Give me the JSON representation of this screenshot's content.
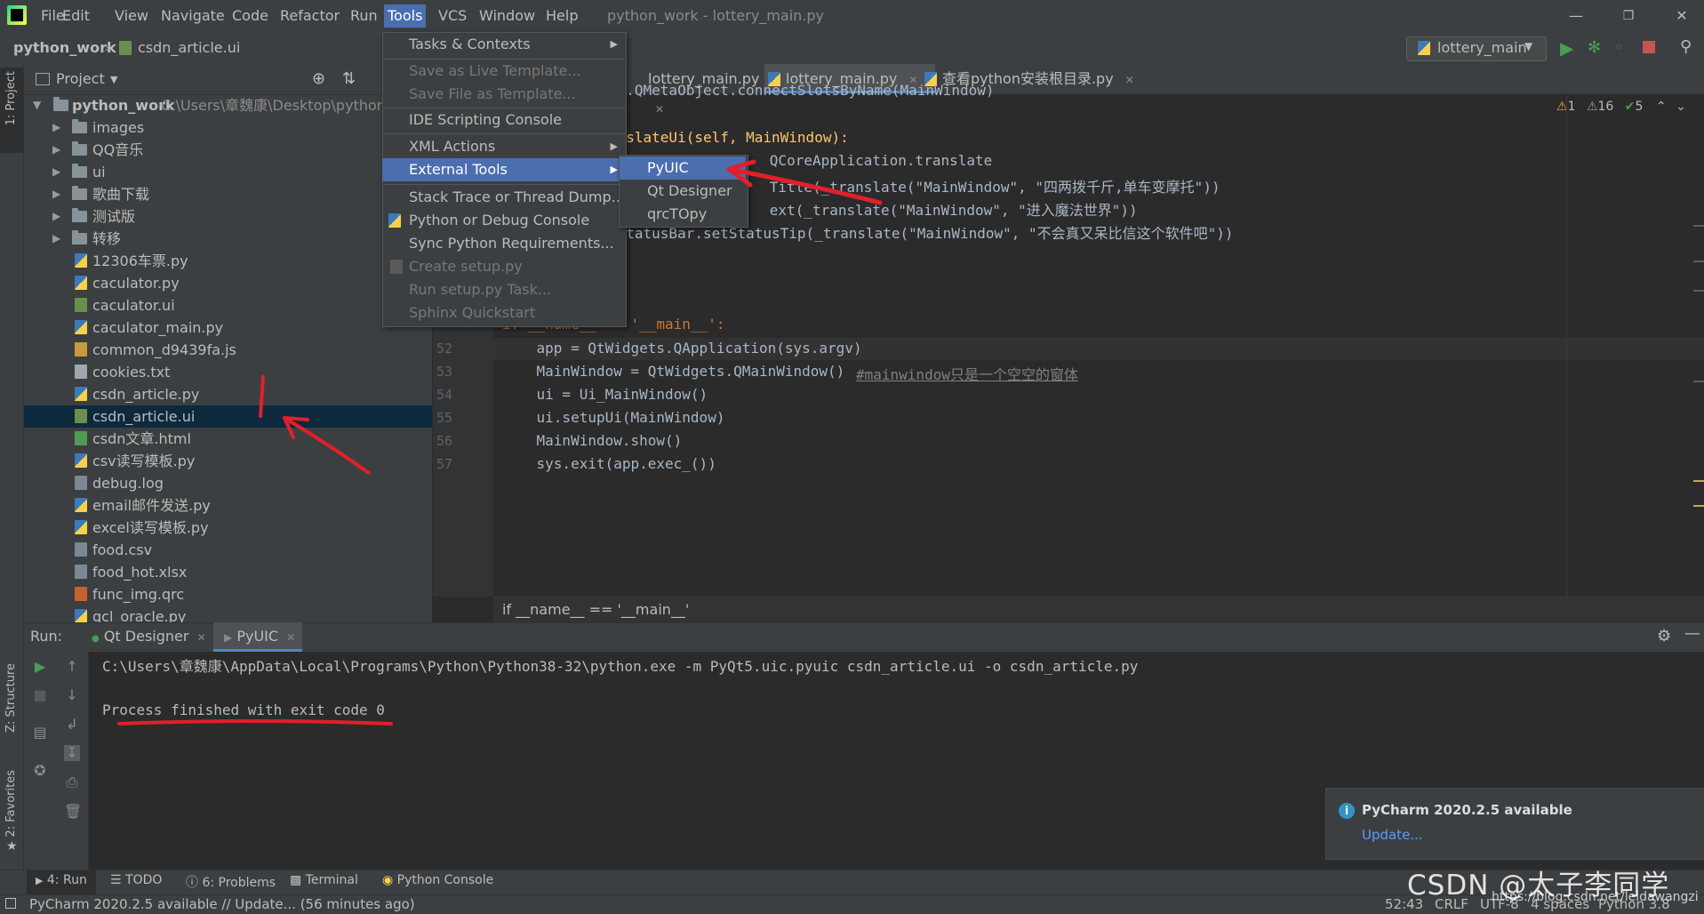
{
  "titlebar": {
    "menu": [
      "File",
      "Edit",
      "View",
      "Navigate",
      "Code",
      "Refactor",
      "Run",
      "Tools",
      "VCS",
      "Window",
      "Help"
    ],
    "window_title": "python_work - lottery_main.py"
  },
  "navbar": {
    "project": "python_work",
    "file": "csdn_article.ui",
    "run_config": "lottery_main"
  },
  "left_strip": {
    "project_tab": "1: Project",
    "structure_tab": "Z: Structure",
    "favorites_tab": "2: Favorites"
  },
  "project_panel": {
    "title": "Project",
    "root_name": "python_work",
    "root_path": "C:\\Users\\章魏康\\Desktop\\python_",
    "folders": [
      "images",
      "QQ音乐",
      "ui",
      "歌曲下载",
      "测试版",
      "转移"
    ],
    "files": [
      {
        "name": "12306车票.py",
        "type": "py"
      },
      {
        "name": "caculator.py",
        "type": "py"
      },
      {
        "name": "caculator.ui",
        "type": "ui"
      },
      {
        "name": "caculator_main.py",
        "type": "py"
      },
      {
        "name": "common_d9439fa.js",
        "type": "js"
      },
      {
        "name": "cookies.txt",
        "type": "txt"
      },
      {
        "name": "csdn_article.py",
        "type": "py"
      },
      {
        "name": "csdn_article.ui",
        "type": "ui",
        "selected": true
      },
      {
        "name": "csdn文章.html",
        "type": "html"
      },
      {
        "name": "csv读写模板.py",
        "type": "py"
      },
      {
        "name": "debug.log",
        "type": "log"
      },
      {
        "name": "email邮件发送.py",
        "type": "py"
      },
      {
        "name": "excel读写模板.py",
        "type": "py"
      },
      {
        "name": "food.csv",
        "type": "csv"
      },
      {
        "name": "food_hot.xlsx",
        "type": "xlsx"
      },
      {
        "name": "func_img.qrc",
        "type": "qrc"
      },
      {
        "name": "gcl_oracle.py",
        "type": "py"
      }
    ]
  },
  "tabs": [
    "lottery_main.py",
    "lottery_main.py",
    "查看python安装根目录.py"
  ],
  "inspections": {
    "warn1": "1",
    "warn2": "16",
    "ok": "5"
  },
  "editor": {
    "lines_top": [
      {
        "code": "  .QMetaObject.connectSlotsByName(MainWindow)"
      },
      {
        "code": "  slateUi(self, MainWindow):"
      },
      {
        "code": "      QCoreApplication.translate"
      },
      {
        "code": "      Title(_translate(\"MainWindow\", \"四两拨千斤,单车变摩托\"))"
      },
      {
        "code": "      ext(_translate(\"MainWindow\", \"进入魔法世界\"))"
      },
      {
        "code": "  tatusBar.setStatusTip(_translate(\"MainWindow\", \"不会真又呆比信这个软件吧\"))"
      }
    ],
    "main_line": "if __name__ == '__main__':",
    "line_numbers": [
      "52",
      "53",
      "54",
      "55",
      "56",
      "57"
    ],
    "lines": [
      "    app = QtWidgets.QApplication(sys.argv)",
      "    MainWindow = QtWidgets.QMainWindow()",
      "    ui = Ui_MainWindow()",
      "    ui.setupUi(MainWindow)",
      "    MainWindow.show()",
      "    sys.exit(app.exec_())"
    ],
    "comment": "#mainwindow只是一个空空的窗体",
    "breadcrumb": "if __name__ == '__main__'"
  },
  "tools_menu": {
    "items": [
      {
        "label": "Tasks & Contexts",
        "sub": true
      },
      {
        "label": "Save as Live Template...",
        "disabled": true
      },
      {
        "label": "Save File as Template...",
        "disabled": true
      },
      {
        "label": "IDE Scripting Console"
      },
      {
        "label": "XML Actions",
        "sub": true
      },
      {
        "label": "External Tools",
        "sub": true,
        "highlight": true
      },
      {
        "label": "Stack Trace or Thread Dump..."
      },
      {
        "label": "Python or Debug Console"
      },
      {
        "label": "Sync Python Requirements..."
      },
      {
        "label": "Create setup.py",
        "disabled": true
      },
      {
        "label": "Run setup.py Task...",
        "disabled": true
      },
      {
        "label": "Sphinx Quickstart",
        "disabled": true
      }
    ],
    "external_tools": [
      "PyUIC",
      "Qt Designer",
      "qrcTOpy"
    ]
  },
  "run_panel": {
    "label": "Run:",
    "tabs": [
      "Qt Designer",
      "PyUIC"
    ],
    "command": "C:\\Users\\章魏康\\AppData\\Local\\Programs\\Python\\Python38-32\\python.exe -m PyQt5.uic.pyuic csdn_article.ui -o csdn_article.py",
    "result": "Process finished with exit code 0"
  },
  "toolwindows": [
    "4: Run",
    "TODO",
    "6: Problems",
    "Terminal",
    "Python Console"
  ],
  "notification": {
    "title": "PyCharm 2020.2.5 available",
    "link": "Update..."
  },
  "statusbar": {
    "message": "PyCharm 2020.2.5 available // Update... (56 minutes ago)",
    "position": "52:43",
    "line_sep": "CRLF",
    "encoding": "UTF-8",
    "indent": "4 spaces",
    "interpreter": "Python 3.8"
  },
  "watermark": "CSDN @太子李同学",
  "watermark_url": "https://blog.csdn.net/leidawangzi",
  "colors": {
    "accent": "#4b6eaf",
    "annotation": "#e0202a",
    "selection": "#0d293e"
  }
}
